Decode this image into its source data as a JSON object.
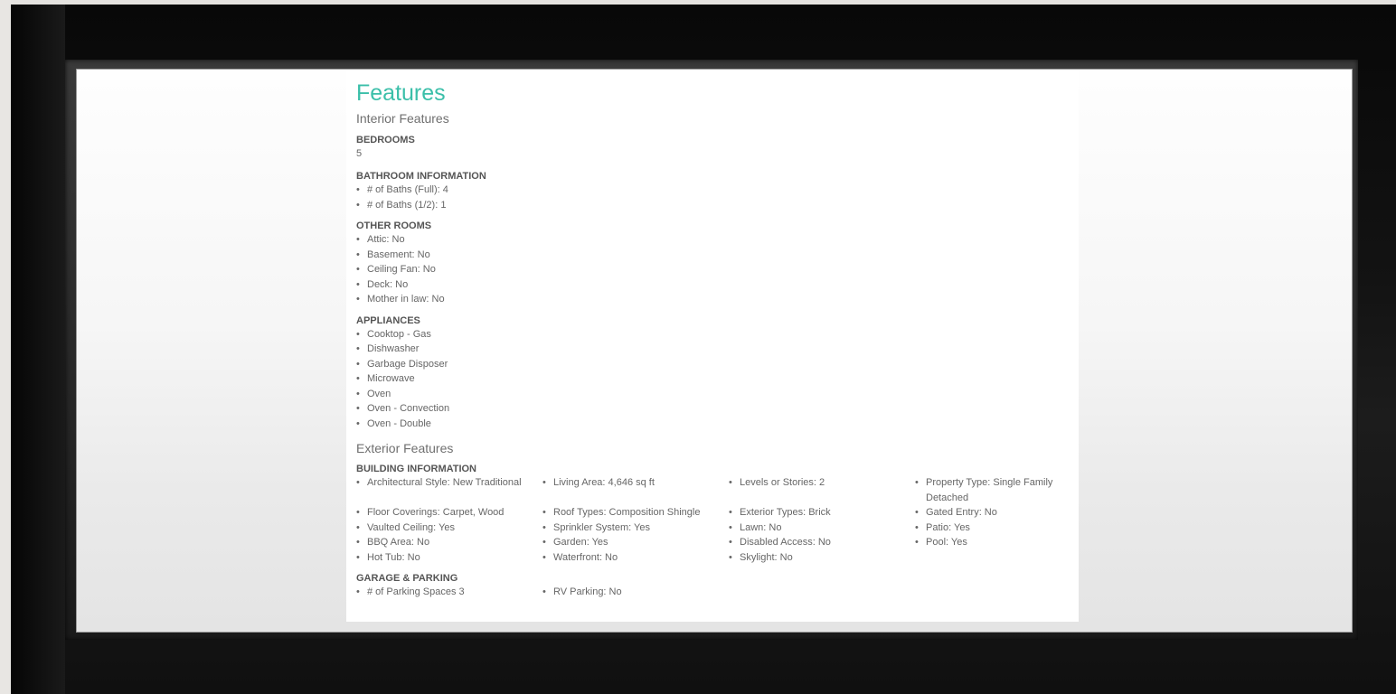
{
  "page": {
    "title": "Features",
    "interior_heading": "Interior Features",
    "exterior_heading": "Exterior Features"
  },
  "interior": {
    "bedrooms": {
      "label": "BEDROOMS",
      "value": "5"
    },
    "bathroom": {
      "label": "BATHROOM INFORMATION",
      "items": [
        "# of Baths (Full): 4",
        "# of Baths (1/2): 1"
      ]
    },
    "other_rooms": {
      "label": "OTHER ROOMS",
      "items": [
        "Attic: No",
        "Basement: No",
        "Ceiling Fan: No",
        "Deck: No",
        "Mother in law: No"
      ]
    },
    "appliances": {
      "label": "APPLIANCES",
      "items": [
        "Cooktop - Gas",
        "Dishwasher",
        "Garbage Disposer",
        "Microwave",
        "Oven",
        "Oven - Convection",
        "Oven - Double"
      ]
    }
  },
  "exterior": {
    "building": {
      "label": "BUILDING INFORMATION",
      "items": [
        "Architectural Style: New Traditional",
        "Living Area: 4,646 sq ft",
        "Levels or Stories: 2",
        "Property Type: Single Family Detached",
        "Floor Coverings: Carpet, Wood",
        "Roof Types: Composition Shingle",
        "Exterior Types: Brick",
        "Gated Entry: No",
        "Vaulted Ceiling: Yes",
        "Sprinkler System: Yes",
        "Lawn: No",
        "Patio: Yes",
        "BBQ Area: No",
        "Garden: Yes",
        "Disabled Access: No",
        "Pool: Yes",
        "Hot Tub: No",
        "Waterfront: No",
        "Skylight: No"
      ]
    },
    "garage": {
      "label": "GARAGE & PARKING",
      "items": [
        "# of Parking Spaces 3",
        "RV Parking: No"
      ]
    }
  },
  "colors": {
    "accent": "#3bbfa9",
    "text": "#666666",
    "frame": "#111111"
  }
}
